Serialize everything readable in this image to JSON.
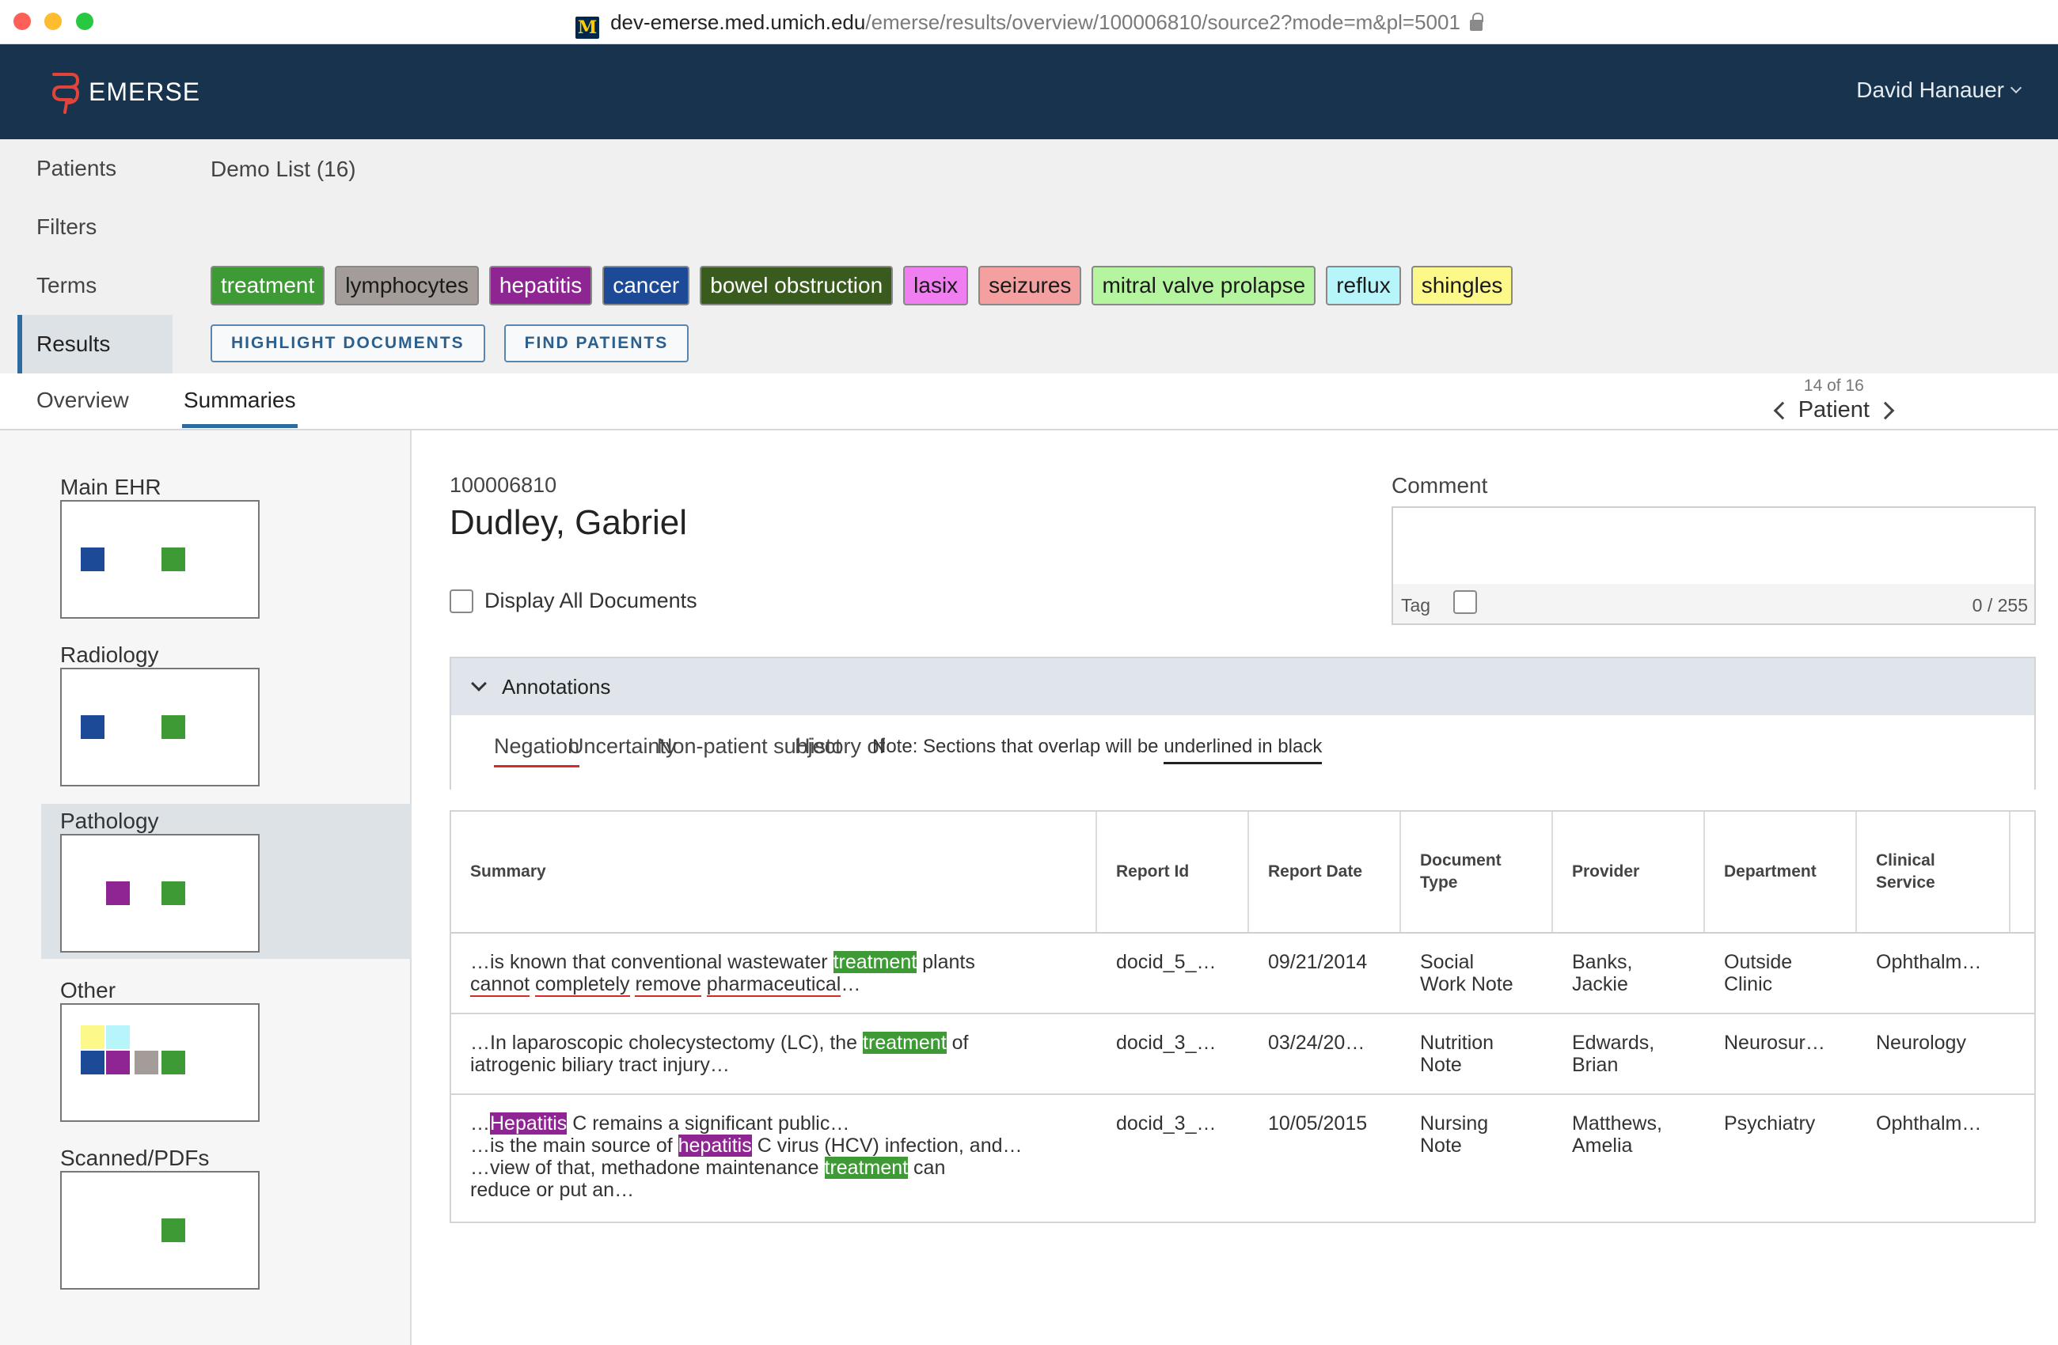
{
  "browser": {
    "url_host": "dev-emerse.med.umich.edu",
    "url_path": "/emerse/results/overview/100006810/source2?mode=m&pl=5001"
  },
  "header": {
    "brand": "EMERSE",
    "user": "David Hanauer"
  },
  "sidebar": {
    "items": [
      {
        "label": "Patients"
      },
      {
        "label": "Filters"
      },
      {
        "label": "Terms"
      },
      {
        "label": "Results"
      }
    ]
  },
  "query": {
    "patient_list": "Demo List (16)",
    "terms": [
      {
        "label": "treatment",
        "bg": "#3d9a35",
        "fg": "#ffffff"
      },
      {
        "label": "lymphocytes",
        "bg": "#a39c98",
        "fg": "#1a1a1a"
      },
      {
        "label": "hepatitis",
        "bg": "#8e2592",
        "fg": "#ffffff"
      },
      {
        "label": "cancer",
        "bg": "#1d4a97",
        "fg": "#ffffff"
      },
      {
        "label": "bowel obstruction",
        "bg": "#395b1d",
        "fg": "#ffffff"
      },
      {
        "label": "lasix",
        "bg": "#f07ef0",
        "fg": "#1a1a1a"
      },
      {
        "label": "seizures",
        "bg": "#f4a0a0",
        "fg": "#1a1a1a"
      },
      {
        "label": "mitral valve prolapse",
        "bg": "#b5f5a0",
        "fg": "#1a1a1a"
      },
      {
        "label": "reflux",
        "bg": "#b6f6fb",
        "fg": "#1a1a1a"
      },
      {
        "label": "shingles",
        "bg": "#fdf88a",
        "fg": "#1a1a1a"
      }
    ],
    "highlight_button": "HIGHLIGHT DOCUMENTS",
    "find_button": "FIND PATIENTS"
  },
  "tabs": {
    "overview": "Overview",
    "summaries": "Summaries"
  },
  "pager": {
    "count": "14 of 16",
    "label": "Patient"
  },
  "sources": [
    {
      "label": "Main EHR"
    },
    {
      "label": "Radiology"
    },
    {
      "label": "Pathology"
    },
    {
      "label": "Other"
    },
    {
      "label": "Scanned/PDFs"
    }
  ],
  "patient": {
    "id": "100006810",
    "name": "Dudley, Gabriel",
    "display_all": "Display All Documents"
  },
  "comment": {
    "label": "Comment",
    "tag": "Tag",
    "count": "0 / 255"
  },
  "annotations": {
    "title": "Annotations",
    "tabs": [
      "Negation",
      "Uncertainty",
      "Non-patient subject",
      "History of"
    ],
    "note_prefix": "Note: Sections that overlap will be ",
    "note_underlined": "underlined in black"
  },
  "table": {
    "headers": {
      "summary": "Summary",
      "report_id": "Report Id",
      "report_date": "Report Date",
      "doc_type_1": "Document",
      "doc_type_2": "Type",
      "provider": "Provider",
      "department": "Department",
      "clinical_1": "Clinical",
      "clinical_2": "Service"
    },
    "rows": [
      {
        "s1a": "…is known that conventional wastewater ",
        "s1hl": "treatment",
        "s1b": " plants",
        "s2a": "cannot",
        "s2b": "completely",
        "s2c": "remove",
        "s2d": "pharmaceutical",
        "s2e": "…",
        "report_id": "docid_5_…",
        "report_date": "09/21/2014",
        "doc_type_1": "Social",
        "doc_type_2": "Work Note",
        "provider_1": "Banks,",
        "provider_2": "Jackie",
        "department_1": "Outside",
        "department_2": "Clinic",
        "clinical": "Ophthalm…"
      },
      {
        "s1a": "…In laparoscopic cholecystectomy (LC), the ",
        "s1hl": "treatment",
        "s1b": " of",
        "s2": "iatrogenic biliary tract injury…",
        "report_id": "docid_3_…",
        "report_date": "03/24/20…",
        "doc_type_1": "Nutrition",
        "doc_type_2": "Note",
        "provider_1": "Edwards,",
        "provider_2": "Brian",
        "department_1": "Neurosur…",
        "clinical": "Neurology"
      },
      {
        "s1a": "…",
        "s1hl": "Hepatitis",
        "s1b": " C remains a significant public…",
        "s2a": "…is the main source of ",
        "s2hl": "hepatitis",
        "s2b": " C virus (HCV) infection, and…",
        "s3a": "…view of that, methadone maintenance ",
        "s3hl": "treatment",
        "s3b": " can",
        "s4": "reduce or put an…",
        "report_id": "docid_3_…",
        "report_date": "10/05/2015",
        "doc_type_1": "Nursing",
        "doc_type_2": "Note",
        "provider_1": "Matthews,",
        "provider_2": "Amelia",
        "department_1": "Psychiatry",
        "clinical": "Ophthalm…"
      }
    ]
  },
  "colors": {
    "header_bg": "#17334d",
    "accent": "#2e6b9e",
    "negation": "#d42a2a"
  }
}
